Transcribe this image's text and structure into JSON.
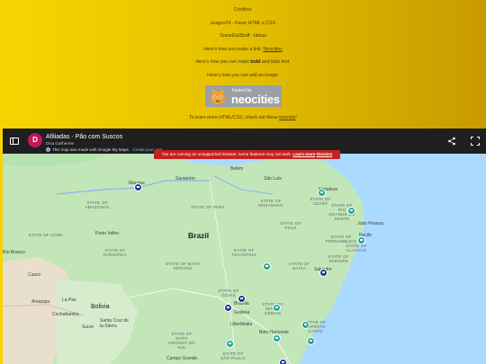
{
  "credits": {
    "title": "Créditos:",
    "line1": "avages24 - Fazer HTML e CSS",
    "line2": "SomeDullStuff - Ideias",
    "link_prefix": "Here's how you make a link:",
    "link_text": "Neocities",
    "bold_prefix": "Here's how you can make",
    "bold_word": "bold",
    "bold_suffix": "and italic text.",
    "image_line": "Here's how you can add an image:",
    "tutorial_prefix": "To learn more HTML/CSS, check out these",
    "tutorial_link": "tutorials",
    "tutorial_suffix": "!"
  },
  "badge": {
    "hosted": "hosted by",
    "brand": "neocities"
  },
  "map_header": {
    "avatar_letter": "D",
    "title": "Afiliadas - Pão com Suscos",
    "author": "Diva Guilherme",
    "note": "This map was made with Google My Maps.",
    "create_link": "Create your own.",
    "warning_text": "You are running an unsupported browser, some features may not work.",
    "warning_link": "Learn more",
    "warning_dismiss": "Dismiss"
  },
  "map": {
    "country_labels": {
      "brazil": "Brazil",
      "bolivia": "Bolivia"
    },
    "states": [
      "STATE OF AMAZONAS",
      "STATE OF PARÁ",
      "STATE OF MARANHÃO",
      "STATE OF CEARÁ",
      "STATE OF RIO GRANDE DO NORTE",
      "STATE OF PIAUÍ",
      "STATE OF PERNAMBUCO",
      "STATE OF ALAGOAS",
      "STATE OF SERGIPE",
      "STATE OF BAHIA",
      "STATE OF TOCANTINS",
      "STATE OF RONDÔNIA",
      "STATE OF ACRE",
      "STATE OF MATO GROSSO",
      "STATE OF GOIÁS",
      "STATE OF MINAS GERAIS",
      "STATE OF MATO GROSSO DO SUL",
      "STATE OF SÃO PAULO",
      "STATE OF ESPÍRITO SANTO"
    ],
    "cities": [
      "Belém",
      "São Luís",
      "Manaus",
      "Santarém",
      "Fortaleza",
      "João Pessoa",
      "Recife",
      "Porto Velho",
      "Rio Branco",
      "Cusco",
      "Arequipa",
      "La Paz",
      "Cochabamba",
      "Santa Cruz de la Sierra",
      "Sucre",
      "Brasília",
      "Goiânia",
      "Uberlândia",
      "Belo Horizonte",
      "Salvador",
      "Campo Grande"
    ]
  },
  "colors": {
    "accent": "#c5221f",
    "pin_navy": "#283593",
    "pin_teal": "#26a69a",
    "water": "#aadaff",
    "land": "#b5e2b0"
  }
}
